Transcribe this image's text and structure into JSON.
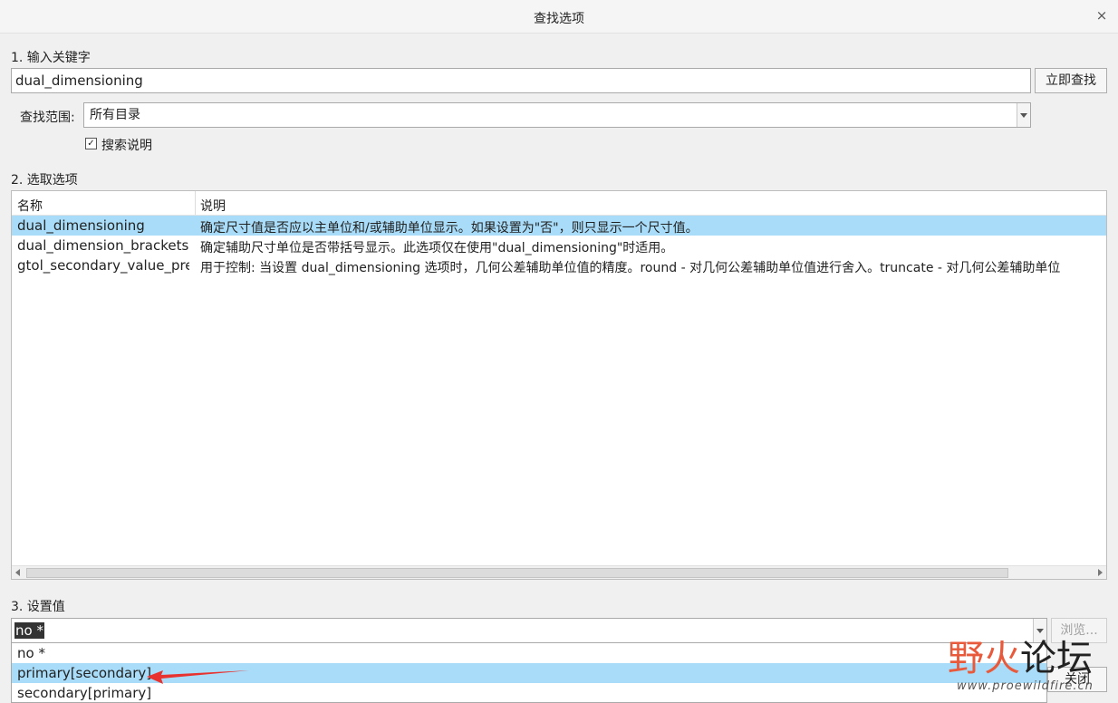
{
  "window": {
    "title": "查找选项"
  },
  "section1": {
    "label": "1. 输入关键字",
    "keyword_value": "dual_dimensioning",
    "search_button": "立即查找",
    "scope_label": "查找范围:",
    "scope_value": "所有目录",
    "search_desc_label": "搜索说明",
    "search_desc_checked": true
  },
  "section2": {
    "label": "2. 选取选项",
    "columns": [
      "名称",
      "说明"
    ],
    "rows": [
      {
        "name": "dual_dimensioning",
        "desc": "确定尺寸值是否应以主单位和/或辅助单位显示。如果设置为\"否\"，则只显示一个尺寸值。",
        "selected": true
      },
      {
        "name": "dual_dimension_brackets",
        "desc": "确定辅助尺寸单位是否带括号显示。此选项仅在使用\"dual_dimensioning\"时适用。",
        "selected": false
      },
      {
        "name": "gtol_secondary_value_pre",
        "desc": "用于控制: 当设置 dual_dimensioning 选项时，几何公差辅助单位值的精度。round - 对几何公差辅助单位值进行舍入。truncate - 对几何公差辅助单位",
        "selected": false
      }
    ]
  },
  "section3": {
    "label": "3. 设置值",
    "current_value": "no *",
    "browse_button": "浏览...",
    "options": [
      "no *",
      "primary[secondary]",
      "secondary[primary]"
    ],
    "highlighted_index": 1,
    "close_button": "关闭"
  },
  "watermark": {
    "text_red": "野火",
    "text_dark": "论坛",
    "url": "www.proewildfire.cn"
  },
  "colors": {
    "selection": "#a8dcf8",
    "annotation_arrow": "#e8322f"
  },
  "icons": {
    "close": "×",
    "check": "✓"
  }
}
